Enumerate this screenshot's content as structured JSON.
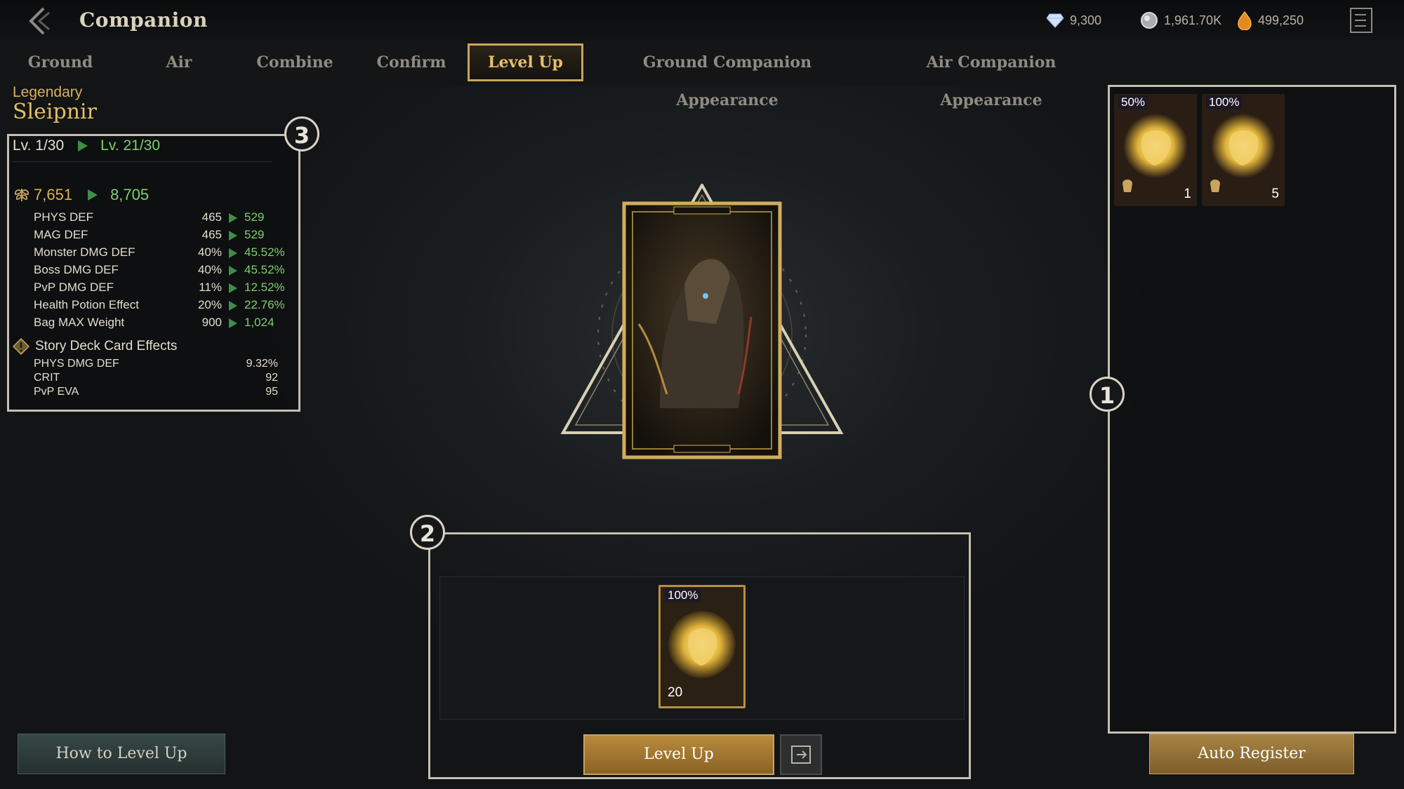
{
  "header": {
    "title": "Companion",
    "currencies": {
      "diamond": {
        "icon": "diamond-icon",
        "value": "9,300"
      },
      "silver": {
        "icon": "silver-coin-icon",
        "value": "1,961.70K"
      },
      "amber": {
        "icon": "amber-gem-icon",
        "value": "499,250"
      }
    }
  },
  "tabs": [
    {
      "label": "Ground",
      "active": false
    },
    {
      "label": "Air",
      "active": false
    },
    {
      "label": "Combine",
      "active": false
    },
    {
      "label": "Confirm",
      "active": false
    },
    {
      "label": "Level Up",
      "active": true
    },
    {
      "label": "Ground Companion Appearance",
      "active": false
    },
    {
      "label": "Air Companion Appearance",
      "active": false
    }
  ],
  "companion": {
    "grade": "Legendary",
    "name": "Sleipnir"
  },
  "stats_panel": {
    "badge": "3",
    "level_current": "Lv. 1/30",
    "level_next": "Lv. 21/30",
    "cp_current": "7,651",
    "cp_next": "8,705",
    "stats": [
      {
        "name": "PHYS DEF",
        "from": "465",
        "to": "529"
      },
      {
        "name": "MAG DEF",
        "from": "465",
        "to": "529"
      },
      {
        "name": "Monster DMG DEF",
        "from": "40%",
        "to": "45.52%"
      },
      {
        "name": "Boss DMG DEF",
        "from": "40%",
        "to": "45.52%"
      },
      {
        "name": "PvP DMG DEF",
        "from": "11%",
        "to": "12.52%"
      },
      {
        "name": "Health Potion Effect",
        "from": "20%",
        "to": "22.76%"
      },
      {
        "name": "Bag MAX Weight",
        "from": "900",
        "to": "1,024"
      }
    ],
    "story_title": "Story Deck Card Effects",
    "story_effects": [
      {
        "name": "PHYS DMG DEF",
        "value": "9.32%"
      },
      {
        "name": "CRIT",
        "value": "92"
      },
      {
        "name": "PvP EVA",
        "value": "95"
      }
    ]
  },
  "enhance": {
    "badge": "2",
    "slot": {
      "percent": "100%",
      "count": "20"
    },
    "level_up_label": "Level Up"
  },
  "inventory": {
    "badge": "1",
    "items": [
      {
        "percent": "50%",
        "count": "1"
      },
      {
        "percent": "100%",
        "count": "5"
      }
    ],
    "auto_register_label": "Auto Register"
  },
  "footer": {
    "how_to_label": "How to Level Up"
  },
  "colors": {
    "accent_gold": "#c9a55e",
    "increase_green": "#7ed06a",
    "panel_border": "#c6bfb0"
  }
}
